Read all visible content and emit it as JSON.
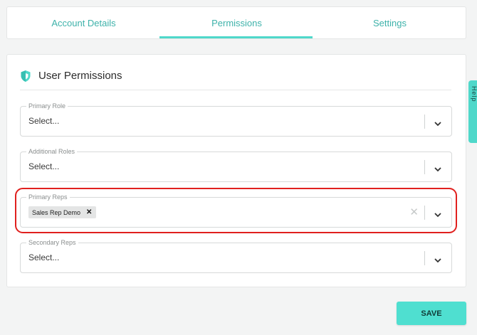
{
  "tabs": [
    {
      "label": "Account Details"
    },
    {
      "label": "Permissions"
    },
    {
      "label": "Settings"
    }
  ],
  "active_tab": "Permissions",
  "section": {
    "title": "User Permissions",
    "icon": "shield-icon"
  },
  "fields": {
    "primary_role": {
      "label": "Primary Role",
      "value": "Select..."
    },
    "additional_roles": {
      "label": "Additional Roles",
      "value": "Select..."
    },
    "primary_reps": {
      "label": "Primary Reps",
      "chips": [
        "Sales Rep Demo"
      ]
    },
    "secondary_reps": {
      "label": "Secondary Reps",
      "value": "Select..."
    }
  },
  "side_tab": {
    "label": "Help"
  },
  "save_button": {
    "label": "SAVE"
  },
  "colors": {
    "accent": "#4fd8ca",
    "tab_text": "#3eb2aa",
    "highlight": "#e0201e"
  }
}
